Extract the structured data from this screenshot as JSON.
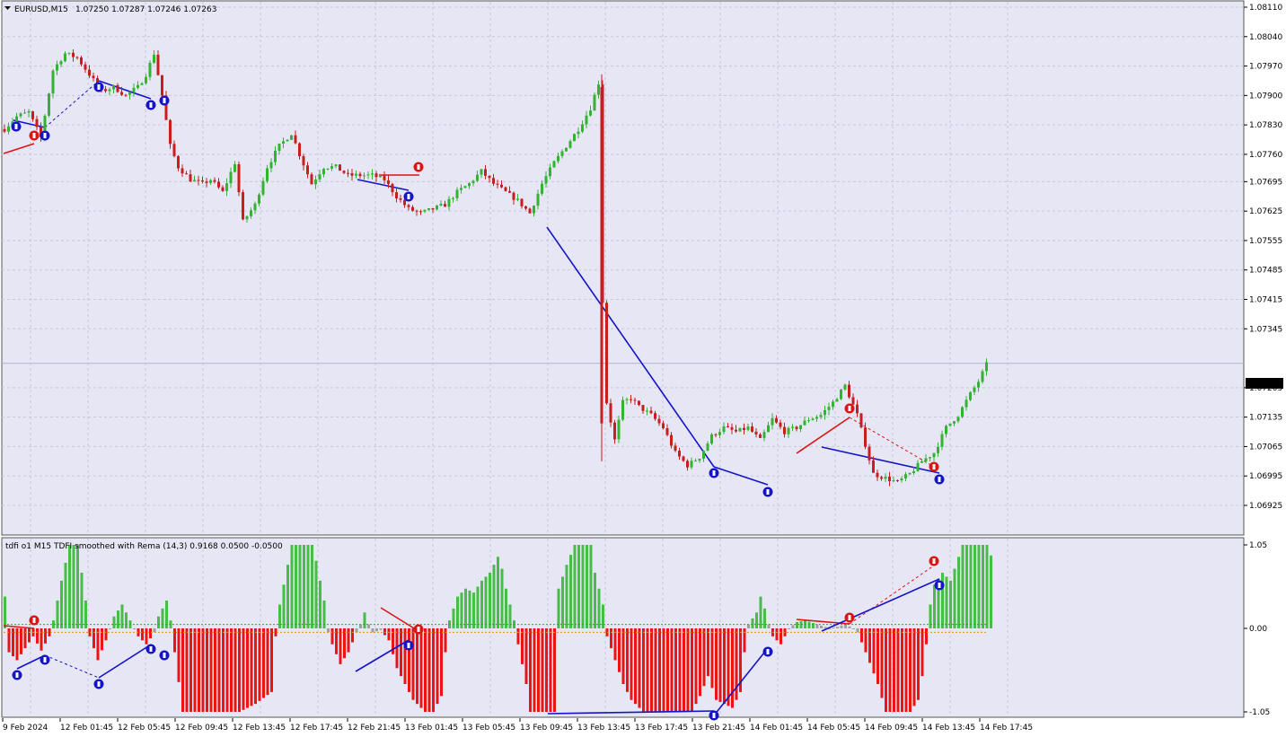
{
  "colors": {
    "chart_bg": "#E6E6F5",
    "grid": "#C8C8DC",
    "bull": "#32B432",
    "bear": "#C81E1E",
    "blue_line": "#1414C8",
    "red_line": "#DC1414",
    "hist_green": "#46BE46",
    "hist_red": "#EB1414",
    "hist_gray": "#A0A0A0",
    "level_green": "#32A032",
    "level_orange": "#E68C1E",
    "price_tag_bg": "#000000",
    "price_tag_fg": "#FFFFFF"
  },
  "main_chart": {
    "title": "EURUSD,M15",
    "ohlc": "1.07250 1.07287 1.07246 1.07263",
    "last_price": "1.07263",
    "price_axis": [
      "1.08110",
      "1.08040",
      "1.07970",
      "1.07900",
      "1.07830",
      "1.07760",
      "1.07695",
      "1.07625",
      "1.07555",
      "1.07485",
      "1.07415",
      "1.07345",
      "1.07205",
      "1.07135",
      "1.07065",
      "1.06995",
      "1.06925"
    ]
  },
  "indicator": {
    "title": "tdfi o1 M15 TDFI smoothed with Rema (14,3) 0.9168 0.0500 -0.0500",
    "axis": [
      "1.05",
      "0.00",
      "-1.05"
    ]
  },
  "time_axis": [
    "9 Feb 2024",
    "12 Feb 01:45",
    "12 Feb 05:45",
    "12 Feb 09:45",
    "12 Feb 13:45",
    "12 Feb 17:45",
    "12 Feb 21:45",
    "13 Feb 01:45",
    "13 Feb 05:45",
    "13 Feb 09:45",
    "13 Feb 13:45",
    "13 Feb 17:45",
    "13 Feb 21:45",
    "14 Feb 01:45",
    "14 Feb 05:45",
    "14 Feb 09:45",
    "14 Feb 13:45",
    "14 Feb 17:45"
  ],
  "chart_data": [
    {
      "type": "candlestick",
      "title": "EURUSD,M15",
      "ylim": [
        1.0689,
        1.0812
      ],
      "x_range": [
        "9 Feb 2024",
        "14 Feb 17:45"
      ],
      "price_path_knots": [
        [
          0,
          1.0782
        ],
        [
          3,
          1.0785
        ],
        [
          6,
          1.0786
        ],
        [
          9,
          1.078
        ],
        [
          12,
          1.0796
        ],
        [
          15,
          1.08
        ],
        [
          18,
          1.0799
        ],
        [
          21,
          1.0795
        ],
        [
          24,
          1.0791
        ],
        [
          27,
          1.0792
        ],
        [
          30,
          1.079
        ],
        [
          33,
          1.0792
        ],
        [
          35,
          1.0795
        ],
        [
          37,
          1.08
        ],
        [
          39,
          1.079
        ],
        [
          41,
          1.0778
        ],
        [
          43,
          1.0773
        ],
        [
          46,
          1.077
        ],
        [
          49,
          1.0769
        ],
        [
          51,
          1.077
        ],
        [
          54,
          1.0767
        ],
        [
          57,
          1.0774
        ],
        [
          59,
          1.076
        ],
        [
          62,
          1.0764
        ],
        [
          65,
          1.0773
        ],
        [
          68,
          1.0778
        ],
        [
          71,
          1.0781
        ],
        [
          73,
          1.0776
        ],
        [
          76,
          1.0769
        ],
        [
          79,
          1.0773
        ],
        [
          82,
          1.0773
        ],
        [
          85,
          1.0771
        ],
        [
          88,
          1.0771
        ],
        [
          91,
          1.0771
        ],
        [
          94,
          1.077
        ],
        [
          97,
          1.0766
        ],
        [
          100,
          1.0763
        ],
        [
          103,
          1.0762
        ],
        [
          106,
          1.0763
        ],
        [
          109,
          1.0764
        ],
        [
          112,
          1.0767
        ],
        [
          115,
          1.0769
        ],
        [
          118,
          1.0772
        ],
        [
          121,
          1.0769
        ],
        [
          124,
          1.0767
        ],
        [
          127,
          1.0765
        ],
        [
          130,
          1.0762
        ],
        [
          133,
          1.0769
        ],
        [
          136,
          1.0774
        ],
        [
          139,
          1.0778
        ],
        [
          142,
          1.0782
        ],
        [
          145,
          1.0787
        ],
        [
          147,
          1.0793
        ],
        [
          148,
          1.0741
        ],
        [
          149,
          1.0717
        ],
        [
          151,
          1.0708
        ],
        [
          153,
          1.0717
        ],
        [
          155,
          1.0718
        ],
        [
          157,
          1.0716
        ],
        [
          160,
          1.0714
        ],
        [
          163,
          1.0711
        ],
        [
          166,
          1.0705
        ],
        [
          169,
          1.0702
        ],
        [
          172,
          1.0704
        ],
        [
          175,
          1.0709
        ],
        [
          178,
          1.0711
        ],
        [
          181,
          1.071
        ],
        [
          184,
          1.0711
        ],
        [
          187,
          1.0708
        ],
        [
          190,
          1.0713
        ],
        [
          193,
          1.071
        ],
        [
          196,
          1.0711
        ],
        [
          199,
          1.0713
        ],
        [
          202,
          1.0714
        ],
        [
          205,
          1.0717
        ],
        [
          208,
          1.0721
        ],
        [
          211,
          1.0714
        ],
        [
          213,
          1.0707
        ],
        [
          215,
          1.07
        ],
        [
          218,
          1.0699
        ],
        [
          221,
          1.0698
        ],
        [
          224,
          1.07
        ],
        [
          227,
          1.0703
        ],
        [
          230,
          1.0705
        ],
        [
          233,
          1.0711
        ],
        [
          236,
          1.0714
        ],
        [
          239,
          1.0719
        ],
        [
          241,
          1.0722
        ],
        [
          243,
          1.0726
        ]
      ]
    },
    {
      "type": "bar",
      "title": "tdfi o1 M15 TDFI smoothed with Rema (14,3)",
      "ylim": [
        -1.05,
        1.05
      ],
      "levels": [
        0.05,
        -0.05
      ],
      "series": [
        {
          "name": "tdfi",
          "last_value": 0.9168
        }
      ],
      "value_knots": [
        [
          0,
          0.4
        ],
        [
          1,
          -0.3
        ],
        [
          3,
          -0.4
        ],
        [
          5,
          -0.25
        ],
        [
          7,
          -0.1
        ],
        [
          9,
          -0.28
        ],
        [
          11,
          -0.1
        ],
        [
          12,
          0.1
        ],
        [
          14,
          0.6
        ],
        [
          16,
          1.05
        ],
        [
          18,
          1.05
        ],
        [
          20,
          0.35
        ],
        [
          21,
          -0.1
        ],
        [
          23,
          -0.4
        ],
        [
          25,
          -0.15
        ],
        [
          27,
          0.15
        ],
        [
          29,
          0.3
        ],
        [
          31,
          0.1
        ],
        [
          33,
          -0.1
        ],
        [
          35,
          -0.2
        ],
        [
          37,
          -0.05
        ],
        [
          38,
          0.15
        ],
        [
          40,
          0.35
        ],
        [
          41,
          0.1
        ],
        [
          42,
          -0.3
        ],
        [
          44,
          -1.05
        ],
        [
          58,
          -1.05
        ],
        [
          62,
          -0.95
        ],
        [
          66,
          -0.8
        ],
        [
          67,
          -0.1
        ],
        [
          68,
          0.3
        ],
        [
          70,
          0.8
        ],
        [
          71,
          1.05
        ],
        [
          76,
          1.05
        ],
        [
          77,
          0.85
        ],
        [
          79,
          0.35
        ],
        [
          80,
          -0.05
        ],
        [
          81,
          -0.2
        ],
        [
          83,
          -0.45
        ],
        [
          85,
          -0.3
        ],
        [
          87,
          -0.05
        ],
        [
          88,
          0.05
        ],
        [
          89,
          0.2
        ],
        [
          90,
          0.05
        ],
        [
          91,
          -0.05
        ],
        [
          93,
          -0.02
        ],
        [
          95,
          -0.15
        ],
        [
          97,
          -0.5
        ],
        [
          99,
          -0.7
        ],
        [
          101,
          -0.9
        ],
        [
          104,
          -1.05
        ],
        [
          106,
          -1.05
        ],
        [
          108,
          -0.85
        ],
        [
          109,
          -0.3
        ],
        [
          110,
          0.1
        ],
        [
          112,
          0.4
        ],
        [
          114,
          0.5
        ],
        [
          116,
          0.45
        ],
        [
          118,
          0.6
        ],
        [
          120,
          0.7
        ],
        [
          122,
          0.9
        ],
        [
          123,
          0.75
        ],
        [
          124,
          0.5
        ],
        [
          125,
          0.3
        ],
        [
          126,
          0.1
        ],
        [
          127,
          -0.2
        ],
        [
          129,
          -0.7
        ],
        [
          130,
          -1.05
        ],
        [
          136,
          -1.05
        ],
        [
          137,
          0.5
        ],
        [
          139,
          0.8
        ],
        [
          141,
          1.05
        ],
        [
          145,
          1.05
        ],
        [
          146,
          0.7
        ],
        [
          148,
          0.3
        ],
        [
          149,
          -0.1
        ],
        [
          151,
          -0.4
        ],
        [
          153,
          -0.7
        ],
        [
          155,
          -0.9
        ],
        [
          158,
          -1.05
        ],
        [
          170,
          -1.05
        ],
        [
          172,
          -0.85
        ],
        [
          174,
          -0.6
        ],
        [
          176,
          -0.9
        ],
        [
          180,
          -1.0
        ],
        [
          182,
          -0.8
        ],
        [
          183,
          -0.3
        ],
        [
          184,
          0.05
        ],
        [
          186,
          0.2
        ],
        [
          187,
          0.4
        ],
        [
          188,
          0.25
        ],
        [
          189,
          0.05
        ],
        [
          190,
          -0.1
        ],
        [
          192,
          -0.2
        ],
        [
          193,
          -0.1
        ],
        [
          194,
          0.0
        ],
        [
          196,
          0.08
        ],
        [
          198,
          0.1
        ],
        [
          201,
          0.05
        ],
        [
          204,
          0.0
        ],
        [
          206,
          0.02
        ],
        [
          208,
          0.05
        ],
        [
          210,
          0.0
        ],
        [
          211,
          -0.05
        ],
        [
          213,
          -0.3
        ],
        [
          216,
          -0.7
        ],
        [
          218,
          -1.05
        ],
        [
          224,
          -1.05
        ],
        [
          226,
          -0.9
        ],
        [
          227,
          -0.6
        ],
        [
          228,
          -0.2
        ],
        [
          229,
          0.3
        ],
        [
          230,
          0.55
        ],
        [
          232,
          0.7
        ],
        [
          234,
          0.6
        ],
        [
          236,
          0.9
        ],
        [
          237,
          1.05
        ],
        [
          243,
          1.05
        ],
        [
          244,
          0.9168
        ]
      ]
    }
  ]
}
